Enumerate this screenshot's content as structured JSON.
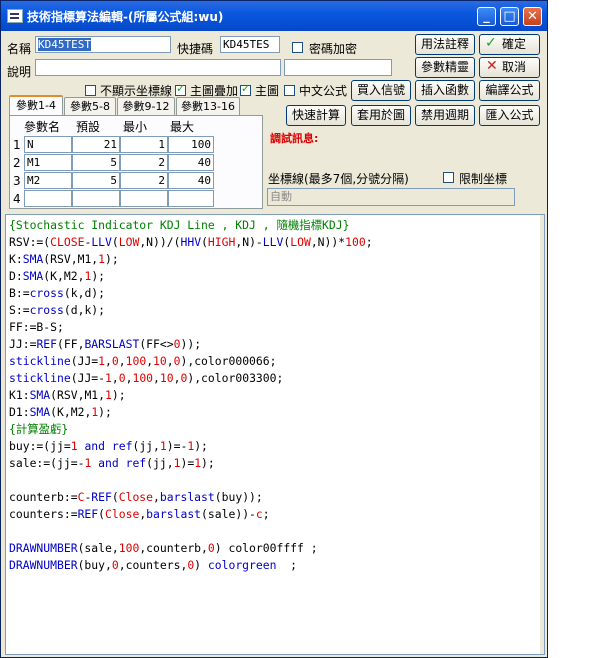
{
  "window": {
    "title": "技術指標算法編輯-(所屬公式組:wu)"
  },
  "form": {
    "name_label": "名稱",
    "name_value": "KD45TEST",
    "shortcode_label": "快捷碼",
    "shortcode_value": "KD45TES",
    "password_label": "密碼加密",
    "desc_label": "說明",
    "desc_value": "",
    "desc2_value": ""
  },
  "buttons": {
    "usage": "用法註釋",
    "ok": "確定",
    "params_wizard": "參數精靈",
    "cancel": "取消",
    "buy_signal": "買入信號",
    "insert_func": "插入函數",
    "compile": "編譯公式",
    "quick_calc": "快速計算",
    "apply_chart": "套用於圖",
    "disable_period": "禁用週期",
    "import": "匯入公式"
  },
  "options": {
    "hide_axis": "不顯示坐標線",
    "main_overlay": "主圖疊加",
    "main_chart": "主圖",
    "chinese_formula": "中文公式"
  },
  "tabs": [
    "參數1-4",
    "參數5-8",
    "參數9-12",
    "參數13-16"
  ],
  "params": {
    "headers": [
      "參數名",
      "預設",
      "最小",
      "最大"
    ],
    "rows": [
      {
        "no": "1",
        "name": "N",
        "default": "21",
        "min": "1",
        "max": "100"
      },
      {
        "no": "2",
        "name": "M1",
        "default": "5",
        "min": "2",
        "max": "40"
      },
      {
        "no": "3",
        "name": "M2",
        "default": "5",
        "min": "2",
        "max": "40"
      },
      {
        "no": "4",
        "name": "",
        "default": "",
        "min": "",
        "max": ""
      }
    ]
  },
  "debug": {
    "label": "調試訊息:"
  },
  "axis": {
    "label": "坐標線(最多7個,分號分隔)",
    "limit_label": "限制坐標",
    "value": "自動"
  },
  "colors": {
    "title_bar": "#0a58e0",
    "debug_text": "#dd0000",
    "code_green": "#008000",
    "code_blue": "#0000c8",
    "code_red": "#dd0000"
  }
}
